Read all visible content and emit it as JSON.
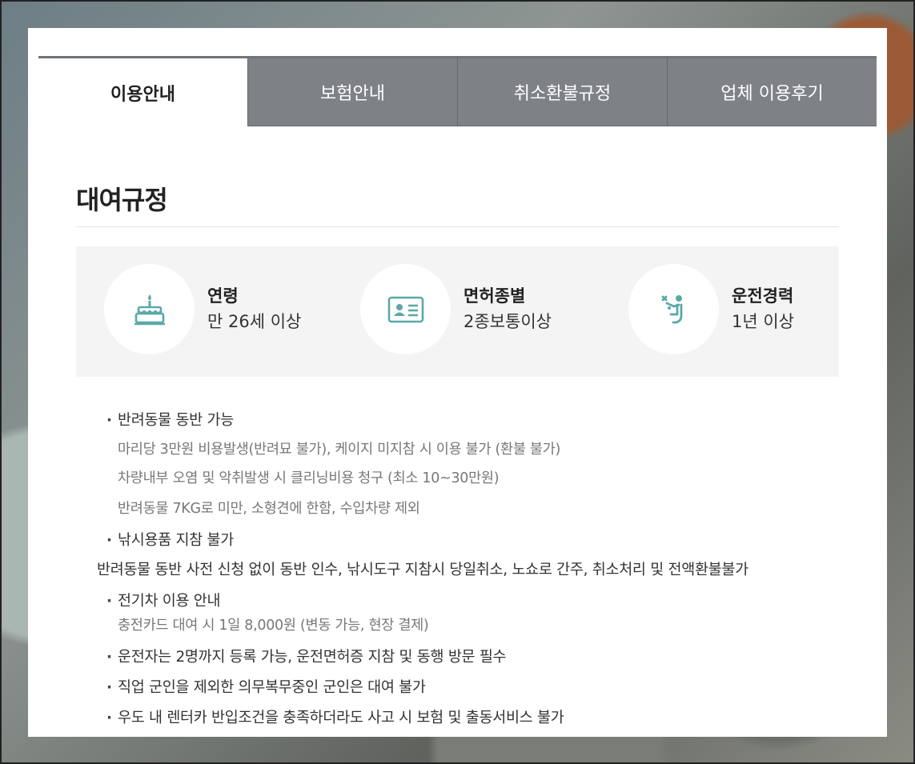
{
  "tabs": [
    {
      "label": "이용안내",
      "active": true
    },
    {
      "label": "보험안내",
      "active": false
    },
    {
      "label": "취소환불규정",
      "active": false
    },
    {
      "label": "업체 이용후기",
      "active": false
    }
  ],
  "section_title": "대여규정",
  "requirements": [
    {
      "icon": "cake-icon",
      "label": "연령",
      "value": "만 26세 이상"
    },
    {
      "icon": "license-card-icon",
      "label": "면허종별",
      "value": "2종보통이상"
    },
    {
      "icon": "driver-icon",
      "label": "운전경력",
      "value": "1년 이상"
    }
  ],
  "notes": {
    "pet": {
      "title": "반려동물 동반 가능",
      "subs": [
        "마리당 3만원 비용발생(반려묘 불가), 케이지 미지참 시 이용 불가 (환불 불가)",
        "차량내부 오염 및 악취발생 시 클리닝비용 청구 (최소 10~30만원)",
        "반려동물 7KG로 미만, 소형견에 한함, 수입차량 제외"
      ]
    },
    "fishing": "낚시용품 지참 불가",
    "penalty": "반려동물 동반 사전 신청 없이 동반 인수, 낚시도구 지참시 당일취소, 노쇼로 간주, 취소처리 및 전액환불불가",
    "ev": {
      "title": "전기차 이용 안내",
      "sub": "충전카드 대여 시 1일 8,000원 (변동 가능, 현장 결제)"
    },
    "drivers": "운전자는 2명까지 등록 가능, 운전면허증 지참 및 동행 방문 필수",
    "military": "직업 군인을 제외한 의무복무중인 군인은 대여 불가",
    "udo": "우도 내 렌터카 반입조건을 충족하더라도 사고 시 보험 및 출동서비스 불가"
  },
  "colors": {
    "accent_icon": "#5aa9a7",
    "tab_inactive": "#7e8287",
    "requirement_bg": "#f4f4f4"
  }
}
